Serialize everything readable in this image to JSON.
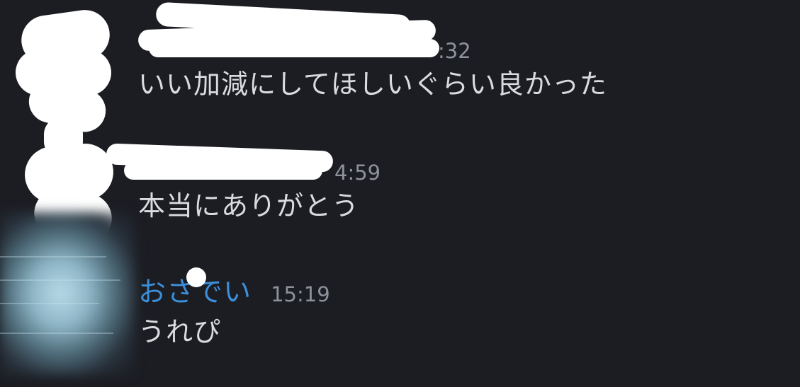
{
  "messages": [
    {
      "timestamp": ":32",
      "text": "いい加減にしてほしいぐらい良かった"
    },
    {
      "timestamp": "4:59",
      "text": "本当にありがとう"
    },
    {
      "username": "おさでい",
      "timestamp": "15:19",
      "text": "うれぴ"
    }
  ],
  "colors": {
    "background": "#1c1d23",
    "username": "#3b8fd9",
    "timestamp": "#8d919b",
    "message_text": "#d9dbe0",
    "redaction": "#ffffff"
  }
}
